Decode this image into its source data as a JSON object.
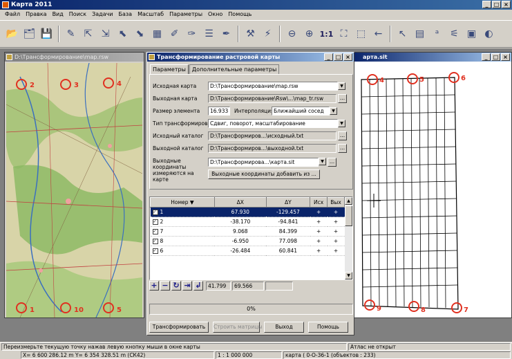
{
  "app": {
    "title": "Карта 2011"
  },
  "menu": [
    "Файл",
    "Правка",
    "Вид",
    "Поиск",
    "Задачи",
    "База",
    "Масштаб",
    "Параметры",
    "Окно",
    "Помощь"
  ],
  "toolbar": {
    "scale_label": "1:1"
  },
  "map_window": {
    "title": "D:\\Трансформирование\\map.rsw",
    "markers": [
      {
        "num": "2"
      },
      {
        "num": "3"
      },
      {
        "num": "4"
      },
      {
        "num": "1"
      },
      {
        "num": "10"
      },
      {
        "num": "5"
      }
    ]
  },
  "grid_window": {
    "title": "арта.sit",
    "markers": [
      {
        "num": "4"
      },
      {
        "num": "5"
      },
      {
        "num": "6"
      },
      {
        "num": "9"
      },
      {
        "num": "8"
      },
      {
        "num": "7"
      }
    ]
  },
  "dialog": {
    "title": "Трансформирование растровой карты",
    "tabs": [
      "Параметры",
      "Дополнительные параметры"
    ],
    "source_map_label": "Исходная карта",
    "source_map_value": "D:\\Трансформирование\\map.rsw",
    "output_map_label": "Выходная карта",
    "output_map_value": "D:\\Трансформирование\\Rsw\\...\\map_tr.rsw",
    "element_size_label": "Размер элемента",
    "element_size_value": "16.933",
    "interpolation_label": "Интерполяция",
    "interpolation_value": "Ближайший сосед",
    "transform_type_label": "Тип трансформирования",
    "transform_type_value": "Сдвиг, поворот, масштабирование",
    "source_dir_label": "Исходный каталог",
    "source_dir_value": "D:\\Трансформиров...\\исходный.txt",
    "output_dir_label": "Выходной каталог",
    "output_dir_value": "D:\\Трансформиров...\\выходной.txt",
    "output_coords_label": "Выходные координаты измеряются на карте",
    "output_coords_value": "D:\\Трансформирова...\\карта.sit",
    "add_coords_button": "Выходные координаты добавить из ...",
    "table": {
      "columns": [
        "Номер",
        "ΔX",
        "ΔY",
        "Исх",
        "Вых"
      ],
      "rows": [
        {
          "num": "1",
          "dx": "67.930",
          "dy": "-129.457",
          "src": "+",
          "out": "+"
        },
        {
          "num": "2",
          "dx": "-38.170",
          "dy": "-94.841",
          "src": "+",
          "out": "+"
        },
        {
          "num": "7",
          "dx": "9.068",
          "dy": "84.399",
          "src": "+",
          "out": "+"
        },
        {
          "num": "8",
          "dx": "-6.950",
          "dy": "77.098",
          "src": "+",
          "out": "+"
        },
        {
          "num": "6",
          "dx": "-26.484",
          "dy": "60.841",
          "src": "+",
          "out": "+"
        }
      ]
    },
    "sum_dx": "41.799",
    "sum_dy": "69.566",
    "progress": "0%",
    "buttons": {
      "transform": "Трансформировать",
      "build_matrix": "Строить матрицы",
      "exit": "Выход",
      "help": "Помощь"
    }
  },
  "status": {
    "hint": "Переизмерьте текущую точку нажав левую кнопку мыши в окне карты",
    "atlas": "Атлас не открыт",
    "coords": "X= 6 600 286.12 m   Y= 6 354 328.51 m  (СК42)",
    "scale": "1 : 1 000 000",
    "sheet": "карта ( 0-О-36-1  (объектов : 233)"
  }
}
